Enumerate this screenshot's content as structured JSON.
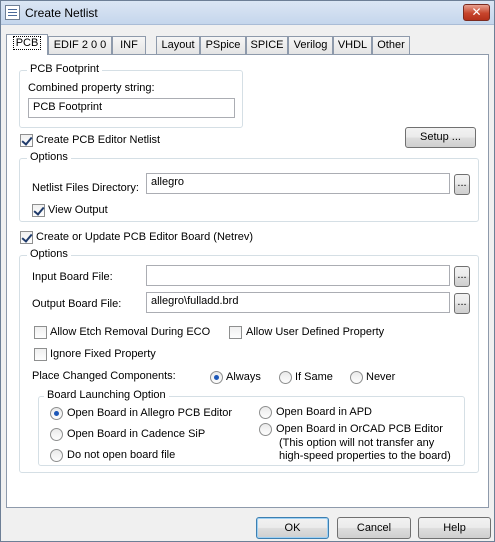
{
  "window": {
    "title": "Create Netlist",
    "close_glyph": "✕"
  },
  "tabs": [
    "PCB",
    "EDIF 2 0 0",
    "INF",
    "Layout",
    "PSpice",
    "SPICE",
    "Verilog",
    "VHDL",
    "Other"
  ],
  "pcb_footprint": {
    "group_label": "PCB Footprint",
    "field_label": "Combined property string:",
    "value": "PCB Footprint"
  },
  "create_netlist": {
    "label": "Create PCB Editor Netlist",
    "checked": true,
    "setup_label": "Setup ..."
  },
  "netlist_options": {
    "group_label": "Options",
    "dir_label": "Netlist Files Directory:",
    "dir_value": "allegro",
    "browse_label": "...",
    "view_output_label": "View Output",
    "view_output_checked": true
  },
  "update_board": {
    "label": "Create or Update PCB Editor Board (Netrev)",
    "checked": true
  },
  "board_options": {
    "group_label": "Options",
    "input_label": "Input Board File:",
    "input_value": "",
    "output_label": "Output Board File:",
    "output_value": "allegro\\fulladd.brd",
    "browse_label": "...",
    "allow_etch_label": "Allow Etch Removal During ECO",
    "allow_user_label": "Allow User Defined Property",
    "ignore_fixed_label": "Ignore Fixed Property",
    "place_changed_label": "Place Changed Components:",
    "place_always": "Always",
    "place_if_same": "If Same",
    "place_never": "Never",
    "place_selected": "Always"
  },
  "launching": {
    "group_label": "Board Launching Option",
    "opt_allegro": "Open Board in Allegro PCB Editor",
    "opt_sip": "Open Board in Cadence SiP",
    "opt_none": "Do not open board file",
    "opt_apd": "Open Board in APD",
    "opt_orcad": "Open Board in OrCAD PCB Editor",
    "orcad_note_1": "(This option will not transfer any",
    "orcad_note_2": "high-speed properties to the board)",
    "selected": "Open Board in Allegro PCB Editor"
  },
  "footer": {
    "ok": "OK",
    "cancel": "Cancel",
    "help": "Help"
  }
}
